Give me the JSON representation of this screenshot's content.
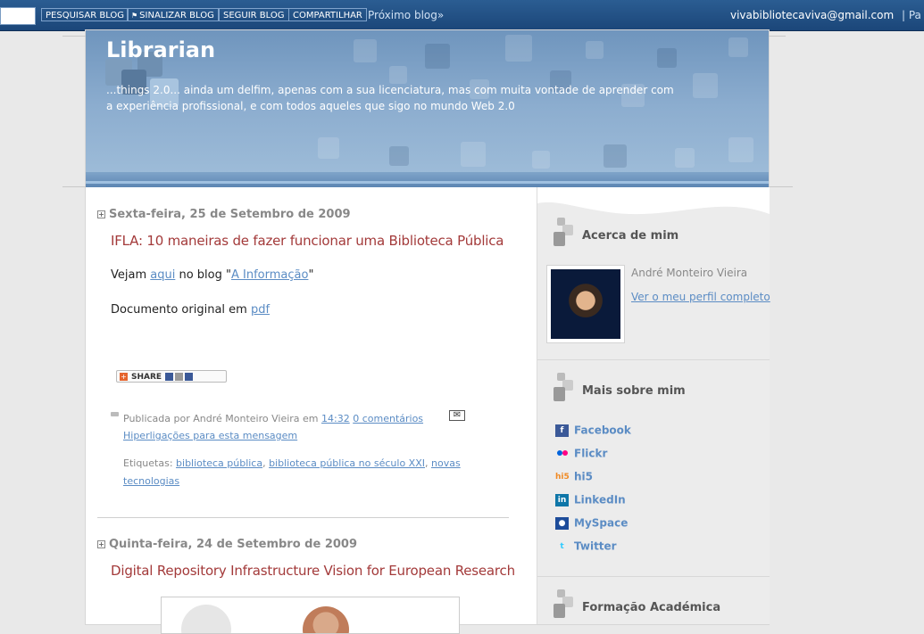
{
  "navbar": {
    "buttons": {
      "search": "PESQUISAR BLOG",
      "flag": "SINALIZAR BLOG",
      "follow": "SEGUIR BLOG",
      "share": "COMPARTILHAR"
    },
    "next_blog": "Próximo blog»",
    "email": "vivabibliotecaviva@gmail.com",
    "truncated": "| Pa"
  },
  "header": {
    "title": "Librarian",
    "description": "...things 2.0... ainda um delfim, apenas com a sua licenciatura, mas com muita vontade de aprender com a experiência profissional, e com todos aqueles que sigo no mundo Web 2.0"
  },
  "posts": [
    {
      "date": "Sexta-feira, 25 de Setembro de 2009",
      "title": "IFLA: 10 maneiras de fazer funcionar uma Biblioteca Pública",
      "line1": {
        "pre": "Vejam ",
        "link1": "aqui",
        "mid": " no blog \"",
        "link2": "A Informação",
        "post": "\""
      },
      "line2": {
        "pre": "Documento original em ",
        "link": "pdf"
      },
      "share_label": "SHARE",
      "footer": {
        "published_by": "Publicada por André Monteiro Vieira em ",
        "time": "14:32",
        "comments": "0 comentários",
        "links": "Hiperligações para esta mensagem",
        "tags_label": "Etiquetas: ",
        "tags": [
          "biblioteca pública",
          "biblioteca pública no século XXI",
          "novas",
          "tecnologias"
        ]
      }
    },
    {
      "date": "Quinta-feira, 24 de Setembro de 2009",
      "title": "Digital Repository Infrastructure Vision for European Research"
    }
  ],
  "sidebar": {
    "about": {
      "heading": "Acerca de mim",
      "name": "André Monteiro Vieira",
      "profile_link": "Ver o meu perfil completo"
    },
    "more": {
      "heading": "Mais sobre mim",
      "links": [
        {
          "label": "Facebook",
          "icon": "facebook-icon",
          "color": "#3b5998"
        },
        {
          "label": "Flickr",
          "icon": "flickr-icon",
          "color": "#0063dc"
        },
        {
          "label": "hi5",
          "icon": "hi5-icon",
          "color": "#f8a331"
        },
        {
          "label": "LinkedIn",
          "icon": "linkedin-icon",
          "color": "#0e76a8"
        },
        {
          "label": "MySpace",
          "icon": "myspace-icon",
          "color": "#1d4c9a"
        },
        {
          "label": "Twitter",
          "icon": "twitter-icon",
          "color": "#33ccff"
        }
      ]
    },
    "education": {
      "heading": "Formação Académica"
    }
  },
  "colors": {
    "navbar": "#1b4679",
    "post_title": "#a33a3a",
    "link": "#5b8cc4"
  }
}
